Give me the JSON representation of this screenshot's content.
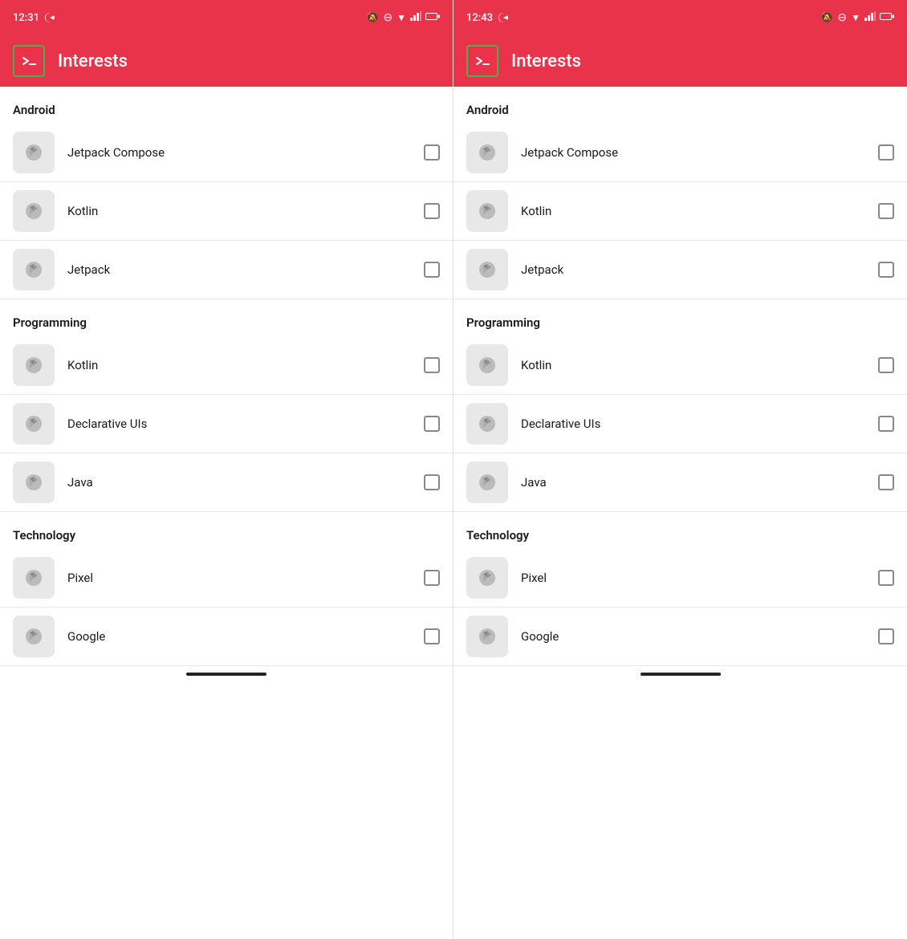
{
  "panels": [
    {
      "id": "left",
      "status_bar": {
        "time": "12:31",
        "icons": [
          "notification-off",
          "minus-circle",
          "wifi",
          "signal",
          "battery"
        ]
      },
      "app_bar": {
        "title": "Interests",
        "icon_label": "terminal-icon"
      },
      "sections": [
        {
          "id": "android-left",
          "header": "Android",
          "items": [
            {
              "id": "jetpack-compose-left",
              "label": "Jetpack Compose",
              "checked": false
            },
            {
              "id": "kotlin-android-left",
              "label": "Kotlin",
              "checked": false
            },
            {
              "id": "jetpack-left",
              "label": "Jetpack",
              "checked": false
            }
          ]
        },
        {
          "id": "programming-left",
          "header": "Programming",
          "items": [
            {
              "id": "kotlin-prog-left",
              "label": "Kotlin",
              "checked": false
            },
            {
              "id": "declarative-left",
              "label": "Declarative UIs",
              "checked": false
            },
            {
              "id": "java-left",
              "label": "Java",
              "checked": false
            }
          ]
        },
        {
          "id": "technology-left",
          "header": "Technology",
          "items": [
            {
              "id": "pixel-left",
              "label": "Pixel",
              "checked": false
            },
            {
              "id": "google-left",
              "label": "Google",
              "checked": false
            }
          ]
        }
      ]
    },
    {
      "id": "right",
      "status_bar": {
        "time": "12:43",
        "icons": [
          "notification-off",
          "minus-circle",
          "wifi",
          "signal",
          "battery"
        ]
      },
      "app_bar": {
        "title": "Interests",
        "icon_label": "terminal-icon"
      },
      "sections": [
        {
          "id": "android-right",
          "header": "Android",
          "items": [
            {
              "id": "jetpack-compose-right",
              "label": "Jetpack Compose",
              "checked": false
            },
            {
              "id": "kotlin-android-right",
              "label": "Kotlin",
              "checked": false
            },
            {
              "id": "jetpack-right",
              "label": "Jetpack",
              "checked": false
            }
          ]
        },
        {
          "id": "programming-right",
          "header": "Programming",
          "items": [
            {
              "id": "kotlin-prog-right",
              "label": "Kotlin",
              "checked": false
            },
            {
              "id": "declarative-right",
              "label": "Declarative UIs",
              "checked": false
            },
            {
              "id": "java-right",
              "label": "Java",
              "checked": false
            }
          ]
        },
        {
          "id": "technology-right",
          "header": "Technology",
          "items": [
            {
              "id": "pixel-right",
              "label": "Pixel",
              "checked": false
            },
            {
              "id": "google-right",
              "label": "Google",
              "checked": false
            }
          ]
        }
      ]
    }
  ]
}
